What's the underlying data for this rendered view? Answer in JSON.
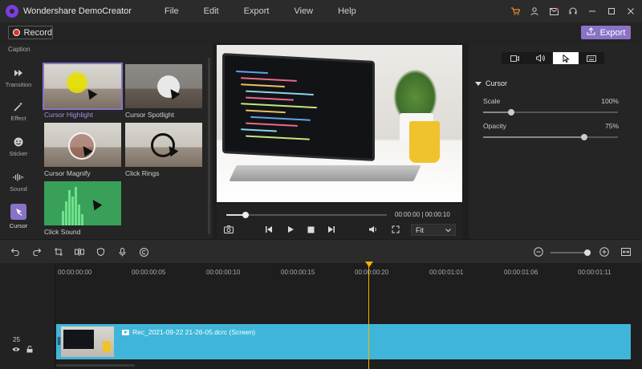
{
  "app": {
    "title": "Wondershare DemoCreator"
  },
  "menu": [
    "File",
    "Edit",
    "Export",
    "View",
    "Help"
  ],
  "title_icons": [
    "cart-icon",
    "user-icon",
    "mail-icon",
    "headset-icon",
    "minimize-icon",
    "maximize-icon",
    "close-icon"
  ],
  "toolbar": {
    "record_label": "Record",
    "export_label": "Export"
  },
  "nav": {
    "caption": "Caption",
    "items": [
      {
        "label": "Transition",
        "icon": "transition-icon"
      },
      {
        "label": "Effect",
        "icon": "effect-icon"
      },
      {
        "label": "Sticker",
        "icon": "sticker-icon"
      },
      {
        "label": "Sound",
        "icon": "sound-icon"
      },
      {
        "label": "Cursor",
        "icon": "cursor-icon",
        "active": true
      }
    ]
  },
  "effects": [
    {
      "label": "Cursor Highlight",
      "selected": true
    },
    {
      "label": "Cursor Spotlight"
    },
    {
      "label": "Cursor Magnify"
    },
    {
      "label": "Click Rings"
    },
    {
      "label": "Click Sound"
    }
  ],
  "player": {
    "current_time": "00:00:00",
    "total_time": "00:00:10",
    "timecode": "00:00:00 | 00:00:10",
    "progress": 0.12,
    "fit_label": "Fit"
  },
  "props": {
    "tabs": [
      "camera-icon",
      "audio-icon",
      "cursor-icon",
      "keyboard-icon"
    ],
    "active_tab": 2,
    "section": "Cursor",
    "scale": {
      "label": "Scale",
      "value": "100%",
      "level": 0.21
    },
    "opacity": {
      "label": "Opacity",
      "value": "75%",
      "level": 0.75
    }
  },
  "timeline": {
    "ruler": [
      "00:00:00:00",
      "00:00:00:05",
      "00:00:00:10",
      "00:00:00:15",
      "00:00:00:20",
      "00:00:01:01",
      "00:00:01:06",
      "00:00:01:11"
    ],
    "track_number": "25",
    "clip_name": "Rec_2021-09-22 21-26-05.dcrc (Screen)",
    "zoom_level": 0.92
  },
  "colors": {
    "accent": "#8a73c7",
    "clip": "#3fb6d9",
    "playhead": "#f0b400",
    "record": "#e0322e"
  }
}
